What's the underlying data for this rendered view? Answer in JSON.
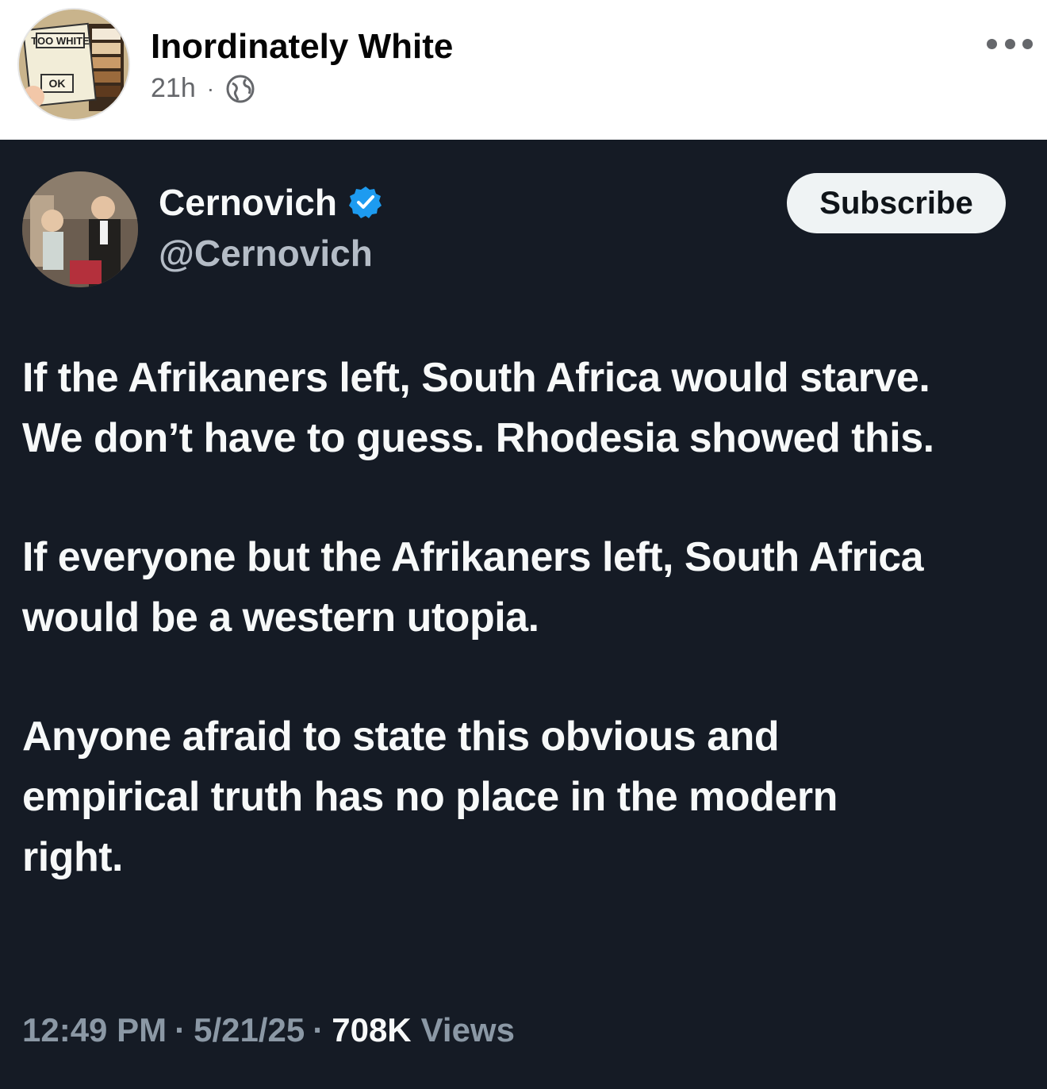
{
  "post": {
    "author": "Inordinately White",
    "time": "21h",
    "separator": "·",
    "avatar_label_top": "TOO WHITE",
    "avatar_label_bottom": "OK"
  },
  "tweet": {
    "name": "Cernovich",
    "handle": "@Cernovich",
    "subscribe_label": "Subscribe",
    "paragraphs": [
      "If the Afrikaners left, South Africa would starve. We don’t have to guess. Rhodesia showed this.",
      "If everyone but the Afrikaners left, South Africa would be a western utopia.",
      "Anyone afraid to state this obvious and empirical truth has no place in the modern right."
    ],
    "time": "12:49 PM",
    "date": "5/21/25",
    "dot": "·",
    "views_count": "708K",
    "views_label": "Views"
  },
  "colors": {
    "tweet_bg": "#151b25",
    "verified_blue": "#1d9bf0",
    "muted_text": "#8b98a5"
  },
  "icons": {
    "globe": "globe-icon",
    "more": "more-dots-icon",
    "verified": "verified-badge-icon"
  }
}
